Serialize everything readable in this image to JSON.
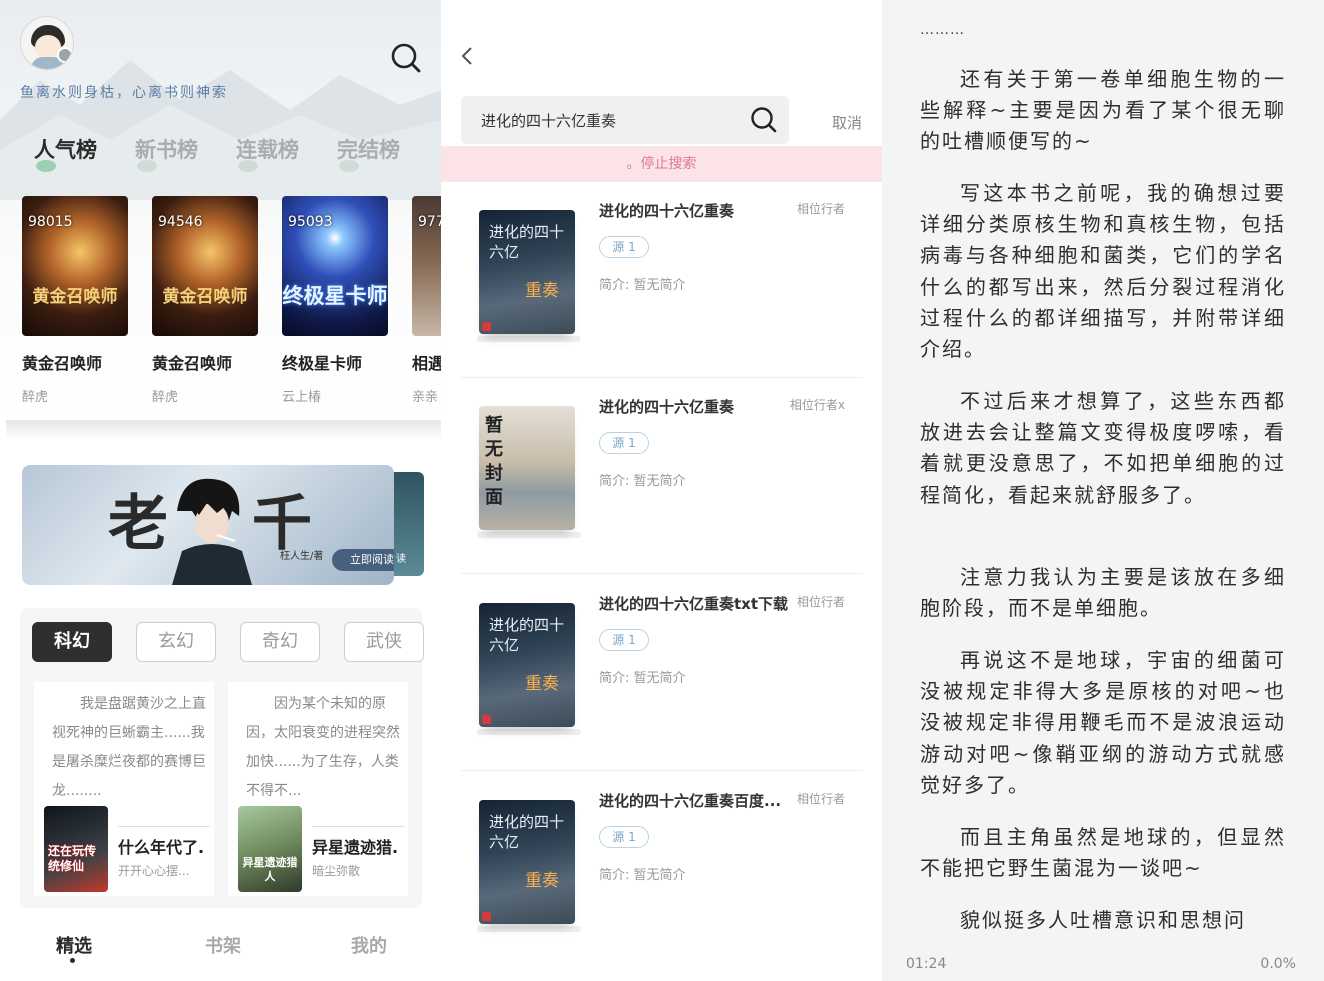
{
  "p1": {
    "motto": "鱼离水则身枯，心离书则神索",
    "tabs": [
      "人气榜",
      "新书榜",
      "连载榜",
      "完结榜"
    ],
    "books": [
      {
        "num": "98015",
        "title": "黄金召唤师",
        "author": "醉虎",
        "cover_text": "黄金召唤师"
      },
      {
        "num": "94546",
        "title": "黄金召唤师",
        "author": "醉虎",
        "cover_text": "黄金召唤师"
      },
      {
        "num": "95093",
        "title": "终极星卡师",
        "author": "云上椿",
        "cover_text": "终极星卡师"
      },
      {
        "num": "977",
        "title": "相遇",
        "author": "亲亲",
        "cover_text": ""
      }
    ],
    "banner": {
      "left_char": "老",
      "right_char": "千",
      "author": "枉人生/著",
      "read_btn": "立即阅读",
      "side_read": "读"
    },
    "categories": [
      "科幻",
      "玄幻",
      "奇幻",
      "武侠"
    ],
    "recs": [
      {
        "desc": "我是盘踞黄沙之上直视死神的巨蜥霸主......我是屠杀糜烂夜都的赛博巨龙........",
        "title": "什么年代了.",
        "author": "开开心心摆...",
        "cover_text": "还在玩传统修仙"
      },
      {
        "desc": "因为某个未知的原因，太阳衰变的进程突然加快......为了生存，人类不得不...",
        "title": "异星遗迹猎.",
        "author": "暗尘弥散",
        "cover_text": "异星遗迹猎人"
      }
    ],
    "nav": [
      "精选",
      "书架",
      "我的"
    ]
  },
  "p2": {
    "query": "进化的四十六亿重奏",
    "cancel": "取消",
    "stop": "。停止搜索",
    "results": [
      {
        "title": "进化的四十六亿重奏",
        "author": "相位行者",
        "source": "源 1",
        "intro": "简介: 暂无简介",
        "cover": "evo"
      },
      {
        "title": "进化的四十六亿重奏",
        "author": "相位行者x",
        "source": "源 1",
        "intro": "简介: 暂无简介",
        "cover": "none"
      },
      {
        "title": "进化的四十六亿重奏txt下载",
        "author": "相位行者",
        "source": "源 1",
        "intro": "简介: 暂无简介",
        "cover": "evo"
      },
      {
        "title": "进化的四十六亿重奏百度...",
        "author": "相位行者",
        "source": "源 1",
        "intro": "简介: 暂无简介",
        "cover": "evo"
      }
    ],
    "cover_evo_title": "进化的四十六亿",
    "cover_evo_sub": "重奏",
    "cover_none_title": "暂无封面"
  },
  "p3": {
    "dots": "………",
    "paragraphs": [
      "还有关于第一卷单细胞生物的一些解释~主要是因为看了某个很无聊的吐槽顺便写的~",
      "写这本书之前呢，我的确想过要详细分类原核生物和真核生物，包括病毒与各种细胞和菌类，它们的学名什么的都写出来，然后分裂过程消化过程什么的都详细描写，并附带详细介绍。",
      "不过后来才想算了，这些东西都放进去会让整篇文变得极度啰嗦，看着就更没意思了，不如把单细胞的过程简化，看起来就舒服多了。",
      "注意力我认为主要是该放在多细胞阶段，而不是单细胞。",
      "再说这不是地球，宇宙的细菌可没被规定非得大多是原核的对吧~也没被规定非得用鞭毛而不是波浪运动游动对吧~像鞘亚纲的游动方式就感觉好多了。",
      "而且主角虽然是地球的，但显然不能把它野生菌混为一谈吧~",
      "貌似挺多人吐槽意识和思想问"
    ],
    "time": "01:24",
    "progress": "0.0%"
  }
}
